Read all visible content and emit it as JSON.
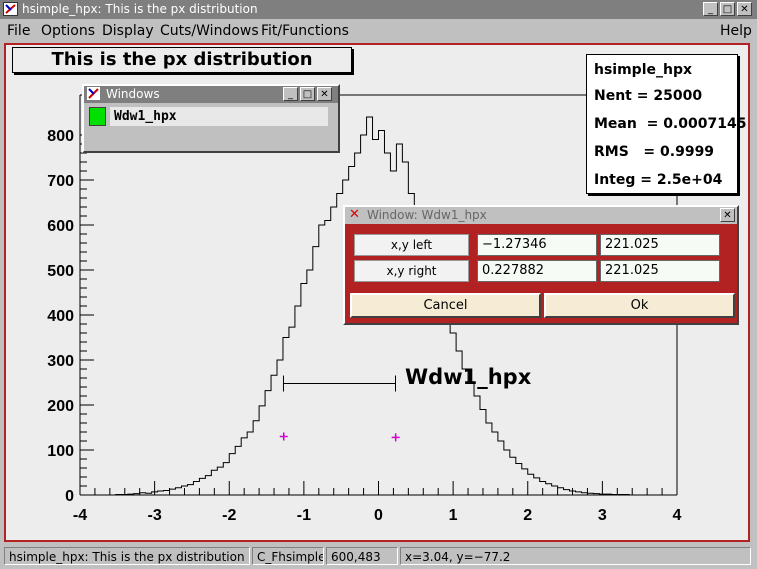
{
  "window": {
    "title": "hsimple_hpx: This is the px distribution"
  },
  "menu": {
    "file": "File",
    "options": "Options",
    "display": "Display",
    "cuts": "Cuts/Windows",
    "fit": "Fit/Functions",
    "help": "Help"
  },
  "plot": {
    "title": "This is the px distribution",
    "stats": {
      "name": "hsimple_hpx",
      "nent": "Nent = 25000",
      "mean": "Mean  = 0.0007145",
      "rms": "RMS   = 0.9999",
      "integ": "Integ = 2.5e+04"
    },
    "window_label": "Wdw1_hpx"
  },
  "chart_data": {
    "type": "histogram",
    "title": "This is the px distribution",
    "xlim": [
      -4,
      4
    ],
    "ylim": [
      0,
      800
    ],
    "xticks": [
      "-4",
      "-3",
      "-2",
      "-1",
      "0",
      "1",
      "2",
      "3",
      "4"
    ],
    "yticks": [
      "0",
      "100",
      "200",
      "300",
      "400",
      "500",
      "600",
      "700",
      "800"
    ],
    "bin_width": 0.08,
    "x_start": -4,
    "values": [
      0,
      0,
      0,
      0,
      0,
      0,
      1,
      1,
      2,
      3,
      5,
      4,
      7,
      9,
      10,
      13,
      16,
      20,
      23,
      30,
      37,
      43,
      55,
      62,
      72,
      92,
      108,
      127,
      140,
      165,
      198,
      232,
      266,
      300,
      350,
      373,
      420,
      470,
      500,
      552,
      600,
      610,
      640,
      670,
      700,
      730,
      760,
      800,
      840,
      790,
      810,
      760,
      720,
      780,
      740,
      670,
      620,
      580,
      540,
      470,
      440,
      400,
      360,
      320,
      280,
      250,
      220,
      190,
      160,
      140,
      120,
      100,
      84,
      70,
      58,
      46,
      38,
      30,
      25,
      20,
      16,
      12,
      9,
      7,
      5,
      4,
      3,
      2,
      2,
      1,
      1,
      1,
      0,
      0,
      0,
      0,
      0,
      0,
      0,
      0
    ],
    "markers": [
      {
        "x": -1.27,
        "y": 130
      },
      {
        "x": 0.23,
        "y": 128
      }
    ],
    "range_bar": {
      "x1": -1.27346,
      "x2": 0.227882,
      "y": 221.025
    }
  },
  "windows_panel": {
    "title": "Windows",
    "item": "Wdw1_hpx",
    "color": "#00e000"
  },
  "dialog": {
    "title": "Window: Wdw1_hpx",
    "left_label": "x,y left",
    "right_label": "x,y right",
    "left_x": "−1.27346",
    "left_y": "221.025",
    "right_x": "0.227882",
    "right_y": "221.025",
    "cancel": "Cancel",
    "ok": "Ok"
  },
  "statusbar": {
    "object": "hsimple_hpx: This is the px distribution",
    "canvas": "C_Fhsimple",
    "pixel": "600,483",
    "coords": "x=3.04, y=−77.2"
  }
}
